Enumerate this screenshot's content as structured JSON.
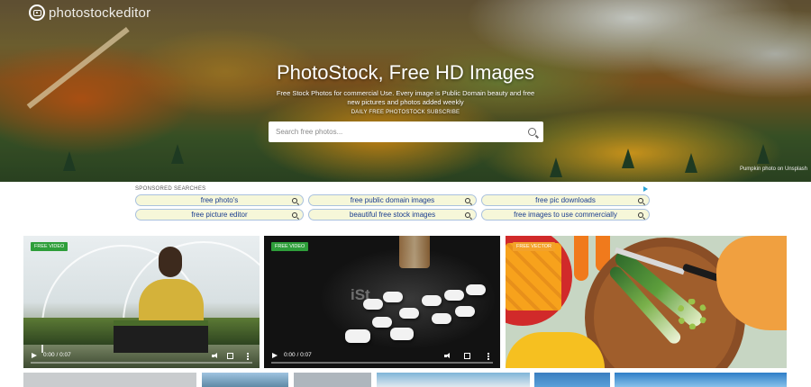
{
  "brand": {
    "name": "photostockeditor"
  },
  "hero": {
    "title": "PhotoStock, Free HD Images",
    "subtitle": "Free Stock Photos for commercial Use. Every image is Public Domain beauty and free new pictures and photos added weekly",
    "link": "DAILY FREE PHOTOSTOCK SUBSCRIBE",
    "search_placeholder": "Search free photos...",
    "credit": "Pumpkin photo on Unsplash"
  },
  "sponsored": {
    "title": "SPONSORED SEARCHES",
    "items": [
      "free photo's",
      "free public domain images",
      "free pic downloads",
      "free picture editor",
      "beautiful free stock images",
      "free images to use commercially"
    ]
  },
  "cards": [
    {
      "badge": "FREE VIDEO",
      "time": "0:00 / 0:07"
    },
    {
      "badge": "FREE VIDEO",
      "time": "0:00 / 0:07",
      "watermark": "iSt"
    },
    {
      "badge": "FREE VECTOR"
    }
  ],
  "colors": {
    "badge": "#2e9e3a",
    "pill_bg": "#f6f7d9",
    "pill_text": "#1a3d8f"
  },
  "icons": [
    "camera-icon",
    "search-icon",
    "play-icon",
    "volume-icon",
    "fullscreen-icon",
    "more-options-icon",
    "adchoices-icon"
  ]
}
